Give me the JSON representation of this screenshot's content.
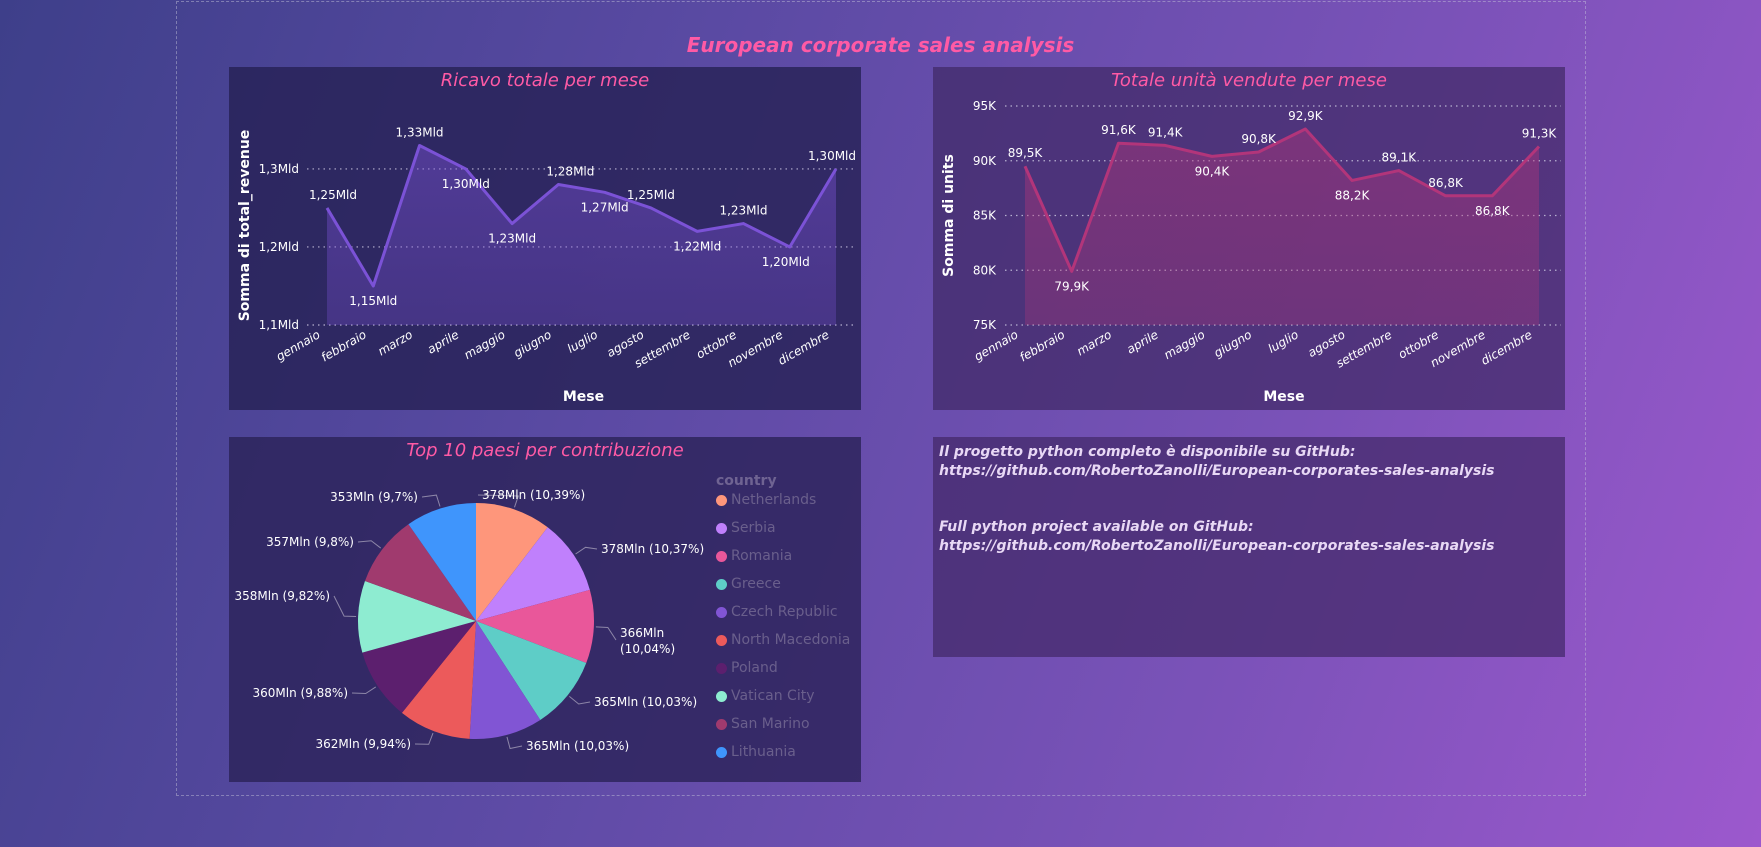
{
  "page_title": "European corporate sales analysis",
  "charts": {
    "revenue": {
      "title": "Ricavo totale per mese"
    },
    "units": {
      "title": "Totale unità vendute per mese"
    },
    "countries": {
      "title": "Top 10 paesi per contribuzione",
      "legend_title": "country"
    }
  },
  "info": {
    "line1": "Il progetto python completo è disponibile su GitHub:",
    "line2": "https://github.com/RobertoZanolli/European-corporates-sales-analysis",
    "line3": "Full python project available on GitHub:",
    "line4": "https://github.com/RobertoZanolli/European-corporates-sales-analysis"
  },
  "colors": {
    "title_pink": "#ff5aa5",
    "revenue_line": "#7b52d6",
    "units_line": "#b2357a"
  },
  "chart_data": [
    {
      "type": "area",
      "title": "Ricavo totale per mese",
      "xlabel": "Mese",
      "ylabel": "Somma di total_revenue",
      "categories": [
        "gennaio",
        "febbraio",
        "marzo",
        "aprile",
        "maggio",
        "giugno",
        "luglio",
        "agosto",
        "settembre",
        "ottobre",
        "novembre",
        "dicembre"
      ],
      "values": [
        1.25,
        1.15,
        1.33,
        1.3,
        1.23,
        1.28,
        1.27,
        1.25,
        1.22,
        1.23,
        1.2,
        1.3
      ],
      "point_labels": [
        "1,25Mld",
        "1,15Mld",
        "1,33Mld",
        "1,30Mld",
        "1,23Mld",
        "1,28Mld",
        "1,27Mld",
        "1,25Mld",
        "1,22Mld",
        "1,23Mld",
        "1,20Mld",
        "1,30Mld"
      ],
      "ylim": [
        1.1,
        1.35
      ],
      "yticks": [
        1.1,
        1.2,
        1.3
      ],
      "ytick_labels": [
        "1,1Mld",
        "1,2Mld",
        "1,3Mld"
      ],
      "grid": true
    },
    {
      "type": "area",
      "title": "Totale unità vendute per mese",
      "xlabel": "Mese",
      "ylabel": "Somma di units",
      "categories": [
        "gennaio",
        "febbraio",
        "marzo",
        "aprile",
        "maggio",
        "giugno",
        "luglio",
        "agosto",
        "settembre",
        "ottobre",
        "novembre",
        "dicembre"
      ],
      "values": [
        89.5,
        79.9,
        91.6,
        91.4,
        90.4,
        90.8,
        92.9,
        88.2,
        89.1,
        86.8,
        86.8,
        91.3
      ],
      "point_labels": [
        "89,5K",
        "79,9K",
        "91,6K",
        "91,4K",
        "90,4K",
        "90,8K",
        "92,9K",
        "88,2K",
        "89,1K",
        "86,8K",
        "86,8K",
        "91,3K"
      ],
      "ylim": [
        75,
        95
      ],
      "yticks": [
        75,
        80,
        85,
        90,
        95
      ],
      "ytick_labels": [
        "75K",
        "80K",
        "85K",
        "90K",
        "95K"
      ],
      "grid": true
    },
    {
      "type": "pie",
      "title": "Top 10 paesi per contribuzione",
      "legend_title": "country",
      "legend_position": "right",
      "categories": [
        "Netherlands",
        "Serbia",
        "Romania",
        "Greece",
        "Czech Republic",
        "North Macedonia",
        "Poland",
        "Vatican City",
        "San Marino",
        "Lithuania"
      ],
      "values": [
        10.39,
        10.37,
        10.04,
        10.03,
        10.03,
        9.94,
        9.88,
        9.82,
        9.8,
        9.7
      ],
      "slice_labels": [
        "378Mln (10,39%)",
        "378Mln (10,37%)",
        "366Mln (10,04%)",
        "365Mln (10,03%)",
        "365Mln (10,03%)",
        "362Mln (9,94%)",
        "360Mln (9,88%)",
        "358Mln (9,82%)",
        "357Mln (9,8%)",
        "353Mln (9,7%)"
      ],
      "colors": [
        "#fe967b",
        "#c080fc",
        "#e9579a",
        "#5ecdc7",
        "#8155d4",
        "#ec5a5b",
        "#5c1f6e",
        "#8eecd1",
        "#a03a6e",
        "#3f95fc"
      ]
    }
  ]
}
